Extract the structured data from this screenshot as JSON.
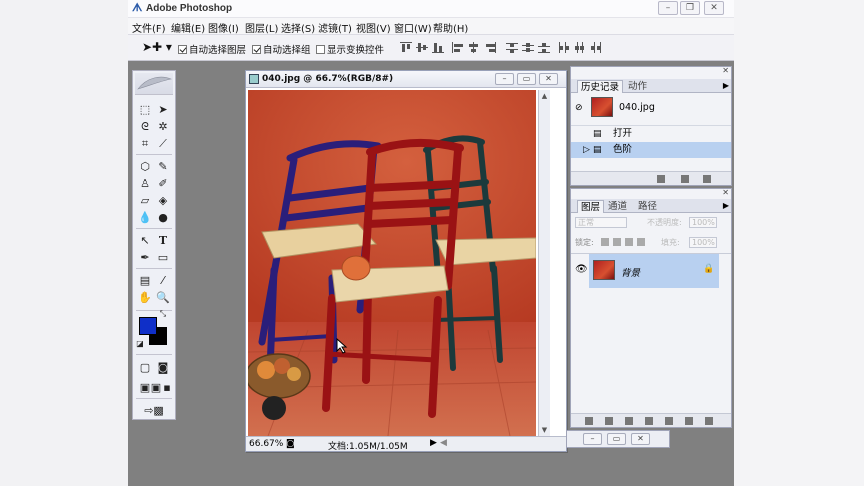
{
  "app": {
    "title": "Adobe Photoshop",
    "window_controls": [
      "minimize",
      "restore",
      "close"
    ]
  },
  "menubar": [
    {
      "label": "文件(F)"
    },
    {
      "label": "编辑(E)"
    },
    {
      "label": "图像(I)"
    },
    {
      "label": "图层(L)"
    },
    {
      "label": "选择(S)"
    },
    {
      "label": "滤镜(T)"
    },
    {
      "label": "视图(V)"
    },
    {
      "label": "窗口(W)"
    },
    {
      "label": "帮助(H)"
    }
  ],
  "options": {
    "auto_select_layer": {
      "label": "自动选择图层",
      "checked": true
    },
    "auto_select_group": {
      "label": "自动选择组",
      "checked": true
    },
    "show_transform": {
      "label": "显示变换控件",
      "checked": false
    }
  },
  "toolbox": {
    "foreground_color": "#0f2fc8",
    "background_color": "#000000"
  },
  "document": {
    "title": "040.jpg @ 66.7%(RGB/8#)",
    "zoom": "66.67%",
    "doc_info": "文档:1.05M/1.05M"
  },
  "history_panel": {
    "tabs": [
      {
        "label": "历史记录",
        "active": true
      },
      {
        "label": "动作",
        "active": false
      }
    ],
    "snapshot": "040.jpg",
    "items": [
      {
        "label": "打开",
        "selected": false
      },
      {
        "label": "色阶",
        "selected": true
      }
    ]
  },
  "layers_panel": {
    "tabs": [
      {
        "label": "图层",
        "active": true
      },
      {
        "label": "通道",
        "active": false
      },
      {
        "label": "路径",
        "active": false
      }
    ],
    "blend_mode": "正常",
    "opacity_label": "不透明度:",
    "opacity_value": "100%",
    "lock_label": "锁定:",
    "fill_label": "填充:",
    "fill_value": "100%",
    "layers": [
      {
        "name": "背景",
        "visible": true,
        "locked": true
      }
    ]
  },
  "colors": {
    "accent": "#b8d0f0",
    "wall": "#c8482a",
    "floor": "#c8553a"
  }
}
